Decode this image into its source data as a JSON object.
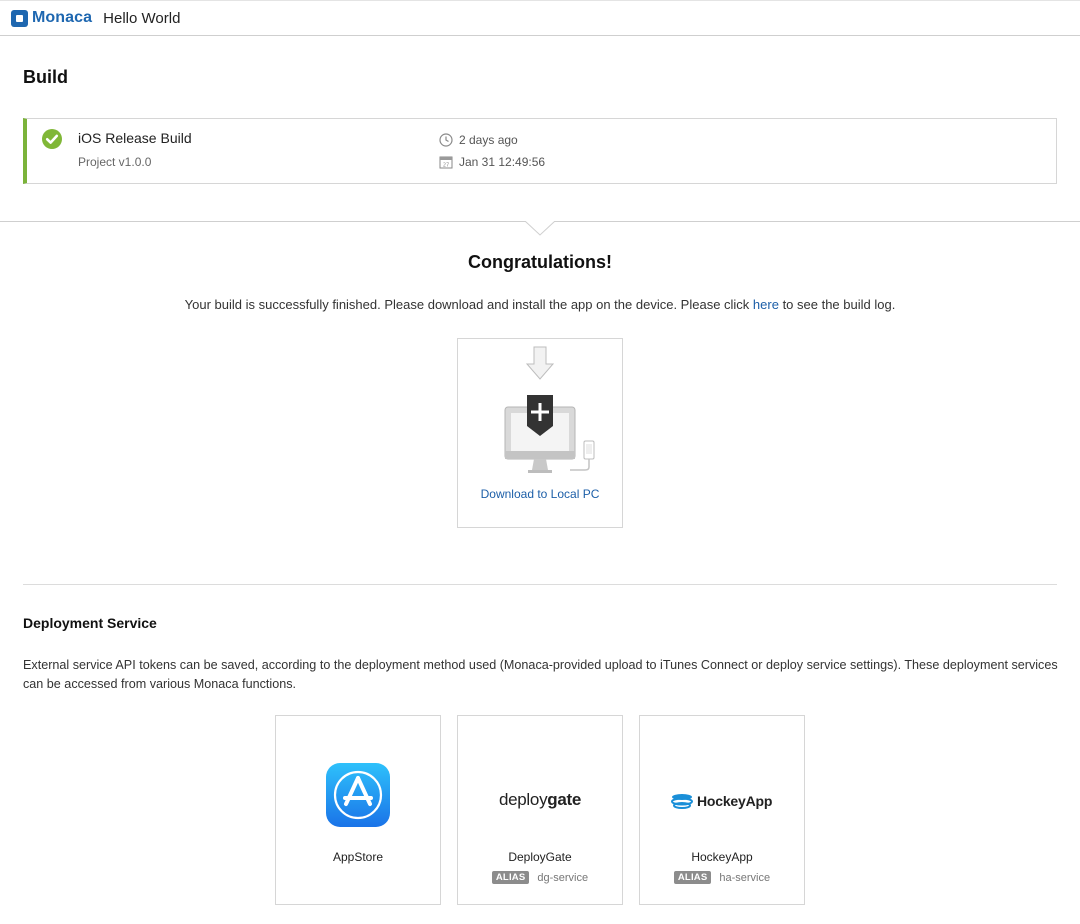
{
  "header": {
    "brand": "Monaca",
    "project_name": "Hello World"
  },
  "build": {
    "section_title": "Build",
    "status_icon": "check-circle-icon",
    "name": "iOS Release Build",
    "version": "Project v1.0.0",
    "relative_time": "2 days ago",
    "timestamp": "Jan 31 12:49:56",
    "status_color": "#7bb33a"
  },
  "congrats": {
    "title": "Congratulations!",
    "message_before": "Your build is successfully finished. Please download and install the app on the device. Please click ",
    "link_text": "here",
    "message_after": " to see the build log."
  },
  "download": {
    "label": "Download to Local PC",
    "icon": "download-to-computer-icon"
  },
  "deployment": {
    "title": "Deployment Service",
    "description": "External service API tokens can be saved, according to the deployment method used (Monaca-provided upload to iTunes Connect or deploy service settings). These deployment services can be accessed from various Monaca functions.",
    "services": [
      {
        "name": "AppStore",
        "icon": "appstore-icon"
      },
      {
        "name": "DeployGate",
        "logo_text_light": "deploy",
        "logo_text_bold": "gate",
        "alias_label": "ALIAS",
        "alias_value": "dg-service"
      },
      {
        "name": "HockeyApp",
        "logo_text": "HockeyApp",
        "alias_label": "ALIAS",
        "alias_value": "ha-service"
      }
    ]
  },
  "colors": {
    "brand": "#1e67b0",
    "link": "#1d5fa8",
    "success": "#80b737"
  }
}
